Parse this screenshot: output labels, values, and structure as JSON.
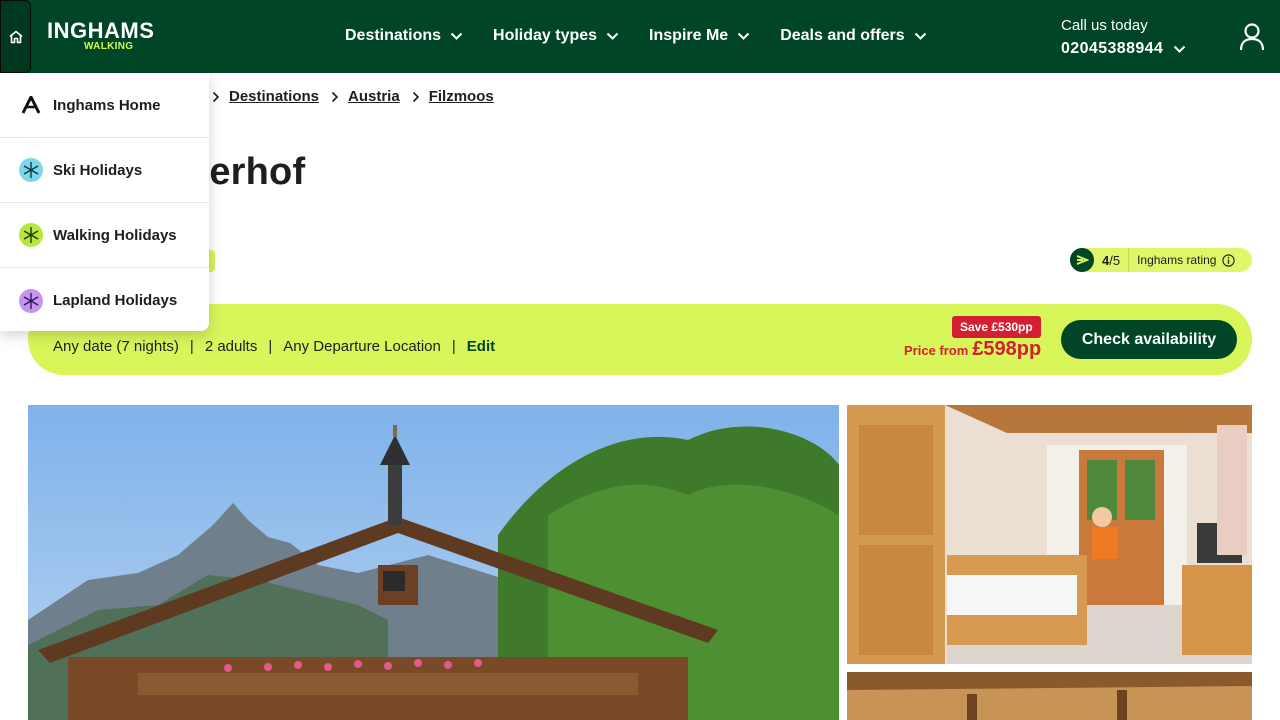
{
  "brand": {
    "name": "INGHAMS",
    "sub": "WALKING"
  },
  "nav": [
    {
      "label": "Destinations"
    },
    {
      "label": "Holiday types"
    },
    {
      "label": "Inspire Me"
    },
    {
      "label": "Deals and offers"
    }
  ],
  "contact": {
    "label": "Call us today",
    "phone": "02045388944"
  },
  "dropdown": [
    {
      "label": "Inghams Home",
      "icon": "inghams-logo-icon"
    },
    {
      "label": "Ski Holidays",
      "icon": "snowflake-icon",
      "color": "#7fd6e8"
    },
    {
      "label": "Walking Holidays",
      "icon": "walking-snowflake-icon",
      "color": "#b9e63a"
    },
    {
      "label": "Lapland Holidays",
      "icon": "lapland-snowflake-icon",
      "color": "#c394f0"
    }
  ],
  "breadcrumb": [
    "Destinations",
    "Austria",
    "Filzmoos"
  ],
  "page": {
    "title_visible": "amerhof"
  },
  "rating": {
    "score": "4",
    "out_of": "/5",
    "label": "Inghams rating"
  },
  "search": {
    "date": "Any date (7 nights)",
    "guests": "2 adults",
    "departure": "Any Departure Location",
    "edit": "Edit"
  },
  "offer": {
    "save": "Save £530pp",
    "price_label": "Price from",
    "price": "£598pp"
  },
  "cta": {
    "label": "Check availability"
  },
  "colors": {
    "brand_green": "#004626",
    "accent_lime": "#d8f65a",
    "sale_red": "#d22030"
  }
}
